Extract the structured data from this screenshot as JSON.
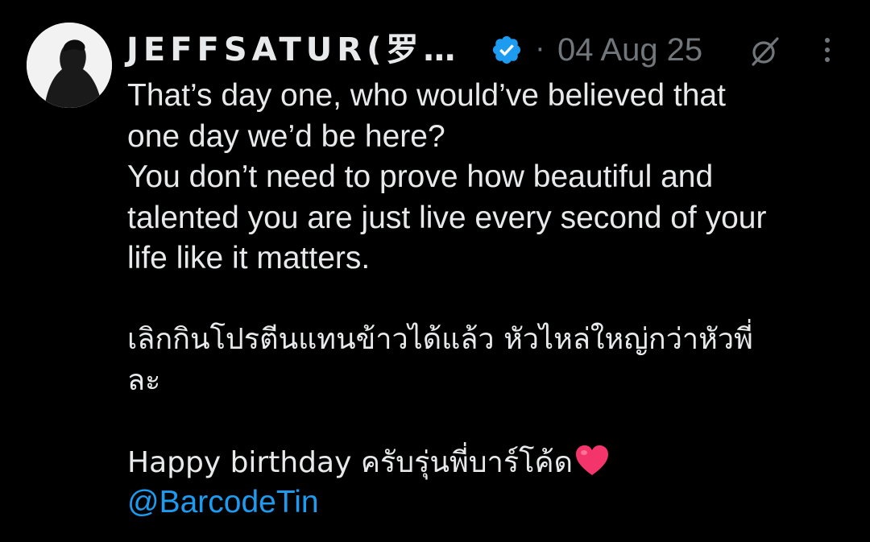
{
  "post": {
    "author": {
      "display_name": "JEFFSATUR(罗…",
      "verified": true,
      "verified_color": "#1d9bf0"
    },
    "separator": "·",
    "date": "04 Aug 25",
    "text_lines": [
      "That’s day one, who would’ve believed that",
      "one day we’d be here?",
      "You don’t need to prove how beautiful and",
      "talented you are just live every second of your",
      "life like it matters."
    ],
    "thai_lines": [
      "เลิกกินโปรตีนแทนข้าวได้แล้ว หัวไหล่ใหญ่กว่าหัวพี่",
      "ละ"
    ],
    "birthday_line": "Happy birthday ครับรุ่นพี่บาร์โค้ด",
    "mention": "@BarcodeTin",
    "icons": {
      "verified": "verified-badge-icon",
      "grok": "grok-icon",
      "more": "more-vertical-icon",
      "heart": "red-heart-emoji-icon"
    },
    "colors": {
      "background": "#000000",
      "text": "#e7e9ea",
      "muted": "#71767b",
      "link": "#1d9bf0",
      "heart": "#f4356b"
    }
  }
}
